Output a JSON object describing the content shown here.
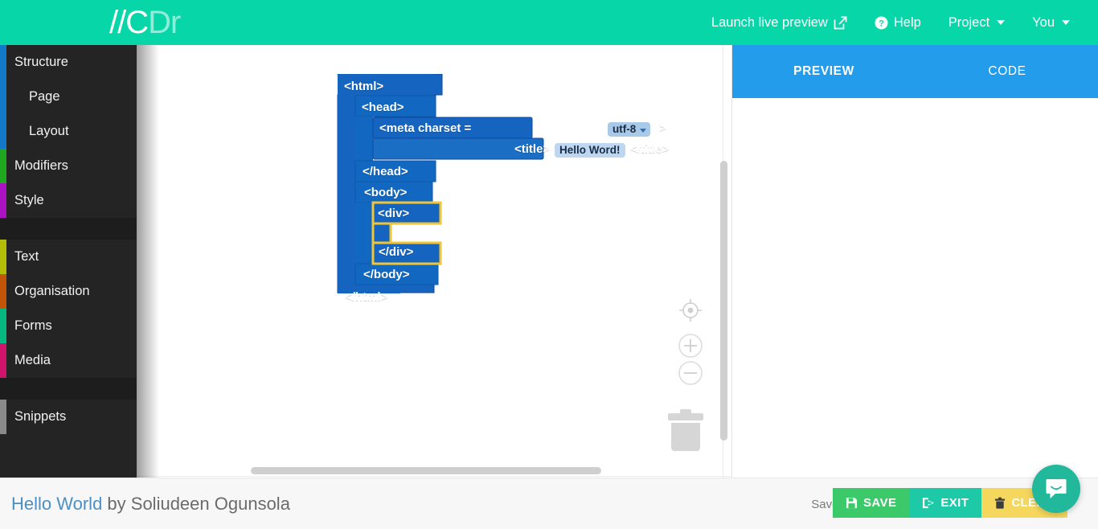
{
  "header": {
    "logo_primary": "//C",
    "logo_secondary": "Dr",
    "nav": [
      {
        "label": "Launch live preview",
        "icon": "external-link-icon"
      },
      {
        "label": "Help",
        "icon": "question-circle-icon"
      },
      {
        "label": "Project",
        "icon": "chevron-down-icon"
      },
      {
        "label": "You",
        "icon": "chevron-down-icon"
      }
    ],
    "background_color": "#06d6a8"
  },
  "sidebar": {
    "background_color": "#242424",
    "groups": [
      {
        "items": [
          {
            "label": "Structure",
            "accent": "#1278c8",
            "indent": false
          },
          {
            "label": "Page",
            "accent": "#1278c8",
            "indent": true
          },
          {
            "label": "Layout",
            "accent": "#1278c8",
            "indent": true
          },
          {
            "label": "Modifiers",
            "accent": "#1fa81f",
            "accent_color": "#1fa81f",
            "indent": false
          },
          {
            "label": "Style",
            "accent": "#ab12c4",
            "indent": false
          }
        ]
      },
      {
        "items": [
          {
            "label": "Text",
            "accent": "#b3bd08",
            "indent": false
          },
          {
            "label": "Organisation",
            "accent": "#c25508",
            "indent": false
          },
          {
            "label": "Forms",
            "accent": "#05b87f",
            "indent": false
          },
          {
            "label": "Media",
            "accent": "#d1136b",
            "indent": false
          }
        ]
      },
      {
        "items": [
          {
            "label": "Snippets",
            "accent": "#8a8a8a",
            "indent": false
          }
        ]
      }
    ]
  },
  "canvas": {
    "block_color": "#1565c0",
    "selected_outline_color": "#f2c537",
    "blocks": [
      {
        "id": "html-open",
        "text": "<html>"
      },
      {
        "id": "head-open",
        "text": "<head>"
      },
      {
        "id": "meta",
        "text_before": "<meta charset =",
        "field_value": "utf-8",
        "text_after": ">"
      },
      {
        "id": "title",
        "text_before": "<title>",
        "field_value": "Hello Word!",
        "text_after": "</title>"
      },
      {
        "id": "head-close",
        "text": "</head>"
      },
      {
        "id": "body-open",
        "text": "<body>"
      },
      {
        "id": "div-open",
        "text": "<div>",
        "selected": true
      },
      {
        "id": "div-close",
        "text": "</div>",
        "selected": true
      },
      {
        "id": "body-close",
        "text": "</body>"
      },
      {
        "id": "html-close",
        "text": "</html>"
      }
    ],
    "tools": [
      {
        "name": "center-target-icon"
      },
      {
        "name": "zoom-in-icon",
        "label": "+"
      },
      {
        "name": "zoom-out-icon",
        "label": "−"
      },
      {
        "name": "trash-icon"
      }
    ]
  },
  "right_panel": {
    "tabs": [
      {
        "label": "PREVIEW",
        "active": true
      },
      {
        "label": "CODE",
        "active": false
      }
    ],
    "tab_background_color": "#239ceb",
    "body_content": ""
  },
  "bottom_bar": {
    "project_name": "Hello World",
    "project_author": " by Soliudeen Ogunsola",
    "status": "Saved.",
    "buttons": [
      {
        "label": "SAVE",
        "icon": "floppy-disk-icon",
        "color": "#3cc96a"
      },
      {
        "label": "EXIT",
        "icon": "sign-out-icon",
        "color": "#1ec9a8"
      },
      {
        "label": "CLEAR",
        "icon": "trash-icon",
        "color": "#f5d75e"
      }
    ],
    "chat_launcher": {
      "name": "intercom-chat-icon",
      "color": "#21b89c"
    }
  }
}
